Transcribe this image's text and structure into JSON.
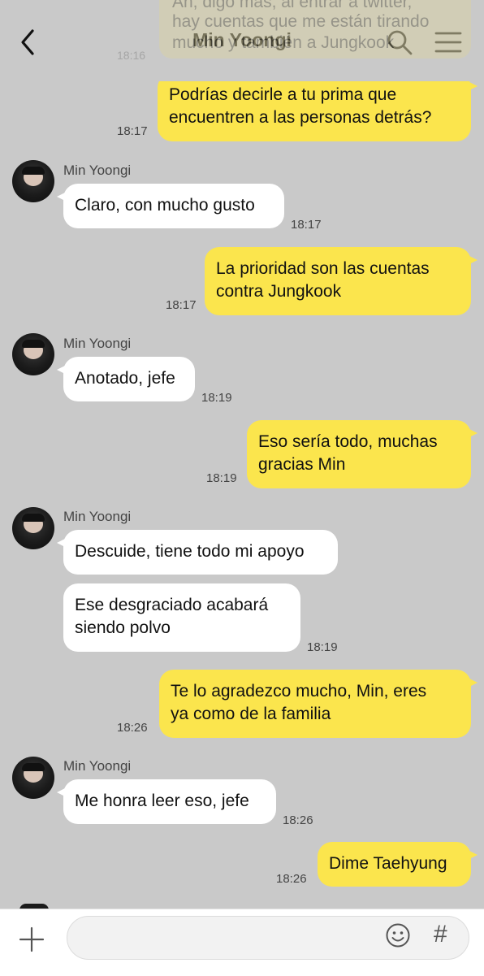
{
  "header": {
    "title": "Min Yoongi"
  },
  "faded": {
    "text_line1": "Ah, digo más, al entrar a twitter,",
    "text_line2": "hay cuentas que me están tirando",
    "text_line3": "mucho y también a Jungkook",
    "time": "18:16"
  },
  "messages": {
    "m1": {
      "line1": "Podrías decirle a tu prima que",
      "line2": "encuentren a las personas detrás?",
      "time": "18:17"
    },
    "m2": {
      "sender": "Min Yoongi",
      "text": "Claro, con mucho gusto",
      "time": "18:17"
    },
    "m3": {
      "line1": "La prioridad son las cuentas",
      "line2": "contra Jungkook",
      "time": "18:17"
    },
    "m4": {
      "sender": "Min Yoongi",
      "text": "Anotado, jefe",
      "time": "18:19"
    },
    "m5": {
      "line1": "Eso sería todo, muchas",
      "line2": "gracias Min",
      "time": "18:19"
    },
    "m6": {
      "sender": "Min Yoongi",
      "text": "Descuide, tiene todo mi apoyo"
    },
    "m7": {
      "line1": "Ese desgraciado acabará",
      "line2": "siendo polvo",
      "time": "18:19"
    },
    "m8": {
      "line1": "Te lo agradezco mucho, Min, eres",
      "line2": "ya como de la familia",
      "time": "18:26"
    },
    "m9": {
      "sender": "Min Yoongi",
      "text": "Me honra leer eso, jefe",
      "time": "18:26"
    },
    "m10": {
      "text": "Dime Taehyung",
      "time": "18:26"
    }
  },
  "footer": {
    "input_value": "",
    "hash_symbol": "#"
  },
  "colors": {
    "background": "#c9c9c9",
    "my_bubble": "#fbe54d",
    "their_bubble": "#ffffff"
  }
}
